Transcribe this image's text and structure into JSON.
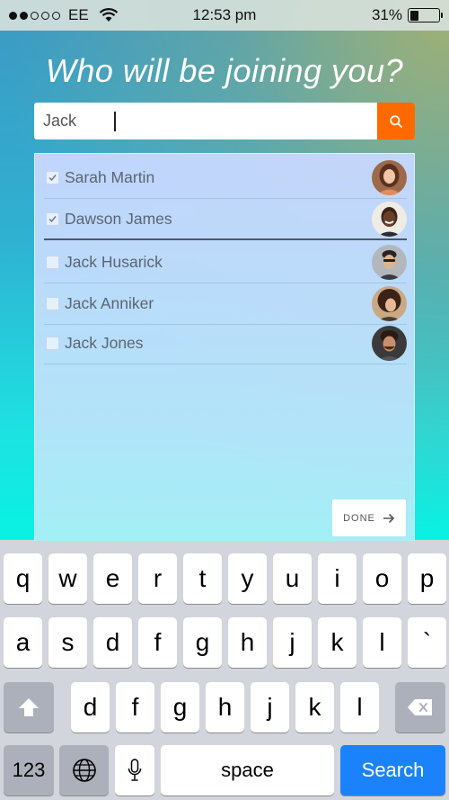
{
  "status_bar": {
    "carrier": "EE",
    "time": "12:53 pm",
    "battery": "31%",
    "battery_level": 0.31
  },
  "title": "Who will be joining you?",
  "search": {
    "value": "Jack"
  },
  "people": [
    {
      "name": "Sarah Martin",
      "checked": true
    },
    {
      "name": "Dawson James",
      "checked": true
    },
    {
      "name": "Jack Husarick",
      "checked": false
    },
    {
      "name": "Jack Anniker",
      "checked": false
    },
    {
      "name": "Jack Jones",
      "checked": false
    }
  ],
  "done_label": "DONE",
  "keyboard": {
    "row1": [
      "q",
      "w",
      "e",
      "r",
      "t",
      "y",
      "u",
      "i",
      "o",
      "p"
    ],
    "row2": [
      "a",
      "s",
      "d",
      "f",
      "g",
      "h",
      "j",
      "k",
      "l",
      "`"
    ],
    "row3": [
      "d",
      "f",
      "g",
      "h",
      "j",
      "k",
      "l"
    ],
    "numbers_label": "123",
    "space_label": "space",
    "search_label": "Search"
  },
  "colors": {
    "accent": "#ff6a00",
    "keyboard_blue": "#1a82fb"
  }
}
